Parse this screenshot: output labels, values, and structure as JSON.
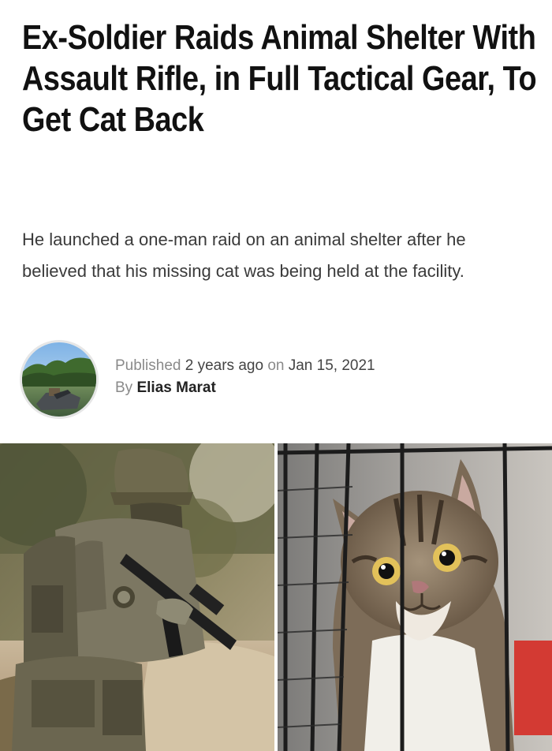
{
  "article": {
    "headline": "Ex-Soldier Raids Animal Shelter With Assault Rifle, in Full Tactical Gear, To Get Cat Back",
    "subtitle": "He launched a one-man raid on an animal shelter after he believed that his missing cat was being held at the facility.",
    "meta": {
      "published_prefix": "Published",
      "relative_time": "2 years ago",
      "on_word": "on",
      "date": "Jan 15, 2021",
      "by_word": "By",
      "author": "Elias Marat"
    },
    "images": {
      "left_icon": "soldier-photo",
      "right_icon": "kitten-in-cage-photo",
      "avatar_icon": "author-avatar-photo"
    }
  }
}
